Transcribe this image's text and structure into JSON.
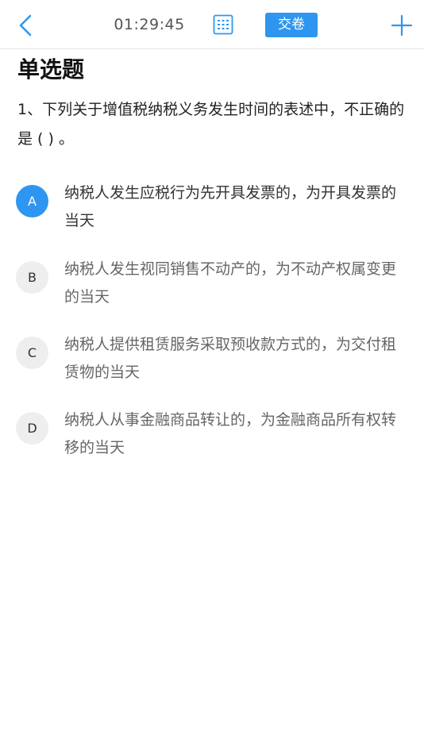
{
  "header": {
    "timer": "01:29:45",
    "submit_label": "交卷",
    "icons": {
      "back": "back-chevron-icon",
      "card": "answer-card-icon",
      "add": "plus-icon"
    },
    "accent_color": "#2e96f0"
  },
  "section_title": "单选题",
  "question": {
    "text": "1、下列关于增值税纳税义务发生时间的表述中，不正确的是 ( ) 。"
  },
  "options": [
    {
      "letter": "A",
      "text": "纳税人发生应税行为先开具发票的，为开具发票的当天",
      "selected": true
    },
    {
      "letter": "B",
      "text": "纳税人发生视同销售不动产的，为不动产权属变更的当天",
      "selected": false
    },
    {
      "letter": "C",
      "text": "纳税人提供租赁服务采取预收款方式的，为交付租赁物的当天",
      "selected": false
    },
    {
      "letter": "D",
      "text": "纳税人从事金融商品转让的，为金融商品所有权转移的当天",
      "selected": false
    }
  ]
}
